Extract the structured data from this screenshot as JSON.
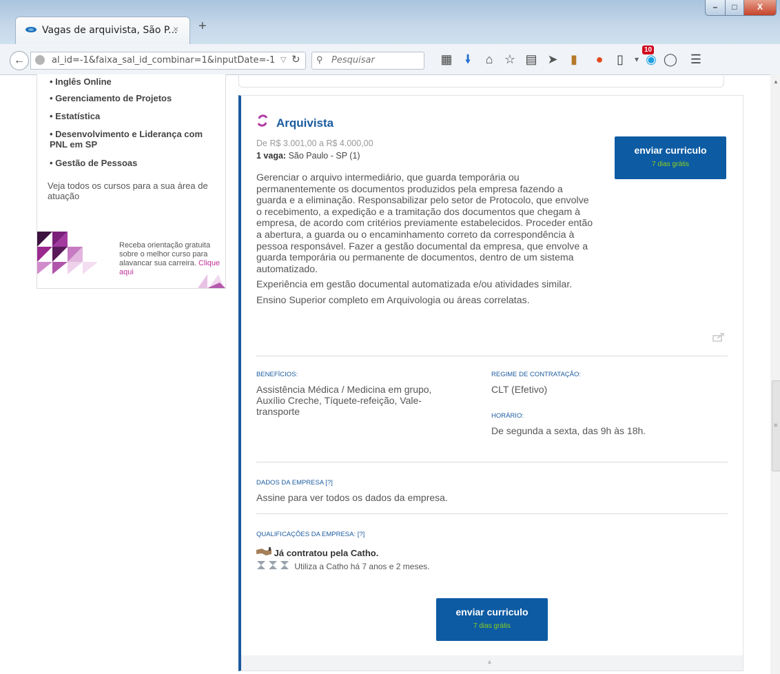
{
  "browser": {
    "tab_title": "Vagas de arquivista, São P...",
    "tab_close": "×",
    "new_tab": "+",
    "url": "al_id=-1&faixa_sal_id_combinar=1&inputDate=-1",
    "search_placeholder": "Pesquisar",
    "notification_count": "10",
    "window_buttons": {
      "minimize": "–",
      "maximize": "□",
      "close": "X"
    }
  },
  "sidebar": {
    "courses": [
      "• Inglês Online",
      "• Gerenciamento de Projetos",
      "• Estatística",
      "• Desenvolvimento e Liderança com PNL em SP",
      "• Gestão de Pessoas"
    ],
    "all_courses_link": "Veja todos os cursos para a sua área de atuação",
    "banner_text": "Receba orientação gratuita sobre o melhor curso para alavancar sua carreira.",
    "banner_link": "Clique aqui"
  },
  "job": {
    "title": "Arquivista",
    "salary": "De R$ 3.001,00 a R$ 4.000,00",
    "vacancy_label": "1 vaga:",
    "vacancy_location": "São Paulo - SP (1)",
    "description": [
      "Gerenciar o arquivo intermediário, que guarda temporária ou permanentemente os documentos produzidos pela empresa fazendo a guarda e a eliminação. Responsabilizar pelo setor de Protocolo, que envolve o recebimento, a expedição e a tramitação dos documentos que chegam à empresa, de acordo com critérios previamente estabelecidos. Proceder então a abertura, a guarda ou o encaminhamento correto da correspondência à pessoa responsável. Fazer a gestão documental da empresa, que envolve a guarda temporária ou permanente de documentos, dentro de um sistema automatizado.",
      "Experiência em gestão documental automatizada e/ou atividades similar.",
      "Ensino Superior completo em Arquivologia ou áreas correlatas."
    ],
    "apply_button": {
      "label": "enviar curriculo",
      "sub": "7 dias grátis"
    },
    "benefits_label": "BENEFÍCIOS:",
    "benefits": "Assistência Médica / Medicina em grupo, Auxílio Creche, Tíquete-refeição, Vale-transporte",
    "contract_label": "REGIME DE CONTRATAÇÃO:",
    "contract": "CLT (Efetivo)",
    "schedule_label": "HORÁRIO:",
    "schedule": "De segunda a sexta, das 9h às 18h.",
    "company_label": "DADOS DA EMPRESA [?]",
    "company_text": "Assine para ver todos os dados da empresa.",
    "qualifications_label": "QUALIFICAÇÕES DA EMPRESA: [?]",
    "hired_text": "Já contratou pela Catho.",
    "usage_text": "Utiliza a Catho há 7 anos e 2 meses."
  },
  "colors": {
    "brand_blue": "#0d5ba3",
    "accent_green": "#8ed11a",
    "link_pink": "#c0309a"
  }
}
